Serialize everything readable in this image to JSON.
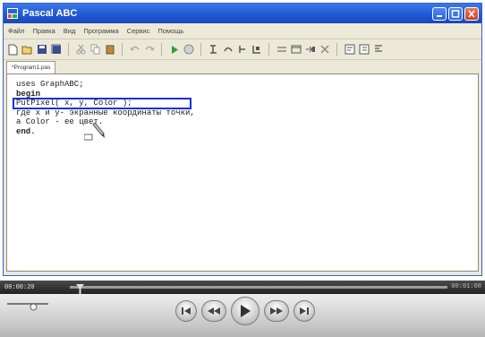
{
  "window": {
    "title": "Pascal ABC"
  },
  "menu": {
    "items": [
      "Файл",
      "Правка",
      "Вид",
      "Программа",
      "Сервис",
      "Помощь"
    ]
  },
  "tabs": [
    {
      "label": "*Program1.pas"
    }
  ],
  "editor": {
    "lines": [
      "uses GraphABC;",
      "begin",
      "PutPixel( x, y, Color );",
      "где x и y- экранные координаты точки,",
      "а Color - ее цвет.",
      "end."
    ],
    "highlighted_line": "PutPixel( x, y, Color );"
  },
  "player": {
    "time_current": "00:00:20",
    "time_total": "00:01:08",
    "progress": 0.02
  },
  "colors": {
    "titlebar": "#1f56d4",
    "highlight_box": "#1a2fd6"
  },
  "icons": {
    "app": "pascal-app-icon",
    "cursor": "pencil-cursor-icon"
  }
}
